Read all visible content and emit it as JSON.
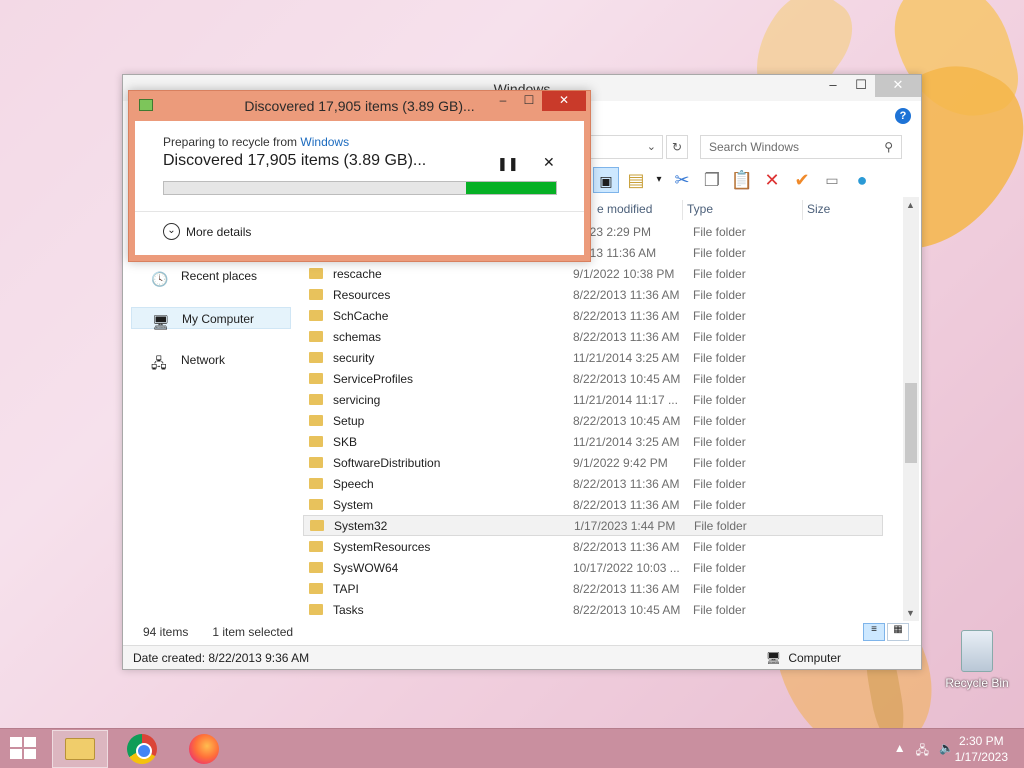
{
  "explorer": {
    "title": "Windows",
    "search_placeholder": "Search Windows",
    "columns": [
      "e modified",
      "Type",
      "Size"
    ],
    "nav_items": [
      "Recent places",
      "My Computer",
      "Network"
    ],
    "rows": [
      {
        "name": "",
        "date": "/2023 2:29 PM",
        "type": "File folder"
      },
      {
        "name": "",
        "date": "/2013 11:36 AM",
        "type": "File folder"
      },
      {
        "name": "rescache",
        "date": "9/1/2022 10:38 PM",
        "type": "File folder"
      },
      {
        "name": "Resources",
        "date": "8/22/2013 11:36 AM",
        "type": "File folder"
      },
      {
        "name": "SchCache",
        "date": "8/22/2013 11:36 AM",
        "type": "File folder"
      },
      {
        "name": "schemas",
        "date": "8/22/2013 11:36 AM",
        "type": "File folder"
      },
      {
        "name": "security",
        "date": "11/21/2014 3:25 AM",
        "type": "File folder"
      },
      {
        "name": "ServiceProfiles",
        "date": "8/22/2013 10:45 AM",
        "type": "File folder"
      },
      {
        "name": "servicing",
        "date": "11/21/2014 11:17 ...",
        "type": "File folder"
      },
      {
        "name": "Setup",
        "date": "8/22/2013 10:45 AM",
        "type": "File folder"
      },
      {
        "name": "SKB",
        "date": "11/21/2014 3:25 AM",
        "type": "File folder"
      },
      {
        "name": "SoftwareDistribution",
        "date": "9/1/2022 9:42 PM",
        "type": "File folder"
      },
      {
        "name": "Speech",
        "date": "8/22/2013 11:36 AM",
        "type": "File folder"
      },
      {
        "name": "System",
        "date": "8/22/2013 11:36 AM",
        "type": "File folder"
      },
      {
        "name": "System32",
        "date": "1/17/2023 1:44 PM",
        "type": "File folder",
        "selected": true
      },
      {
        "name": "SystemResources",
        "date": "8/22/2013 11:36 AM",
        "type": "File folder"
      },
      {
        "name": "SysWOW64",
        "date": "10/17/2022 10:03 ...",
        "type": "File folder"
      },
      {
        "name": "TAPI",
        "date": "8/22/2013 11:36 AM",
        "type": "File folder"
      },
      {
        "name": "Tasks",
        "date": "8/22/2013 10:45 AM",
        "type": "File folder"
      }
    ],
    "item_count": "94 items",
    "selected_count": "1 item selected",
    "date_created": "Date created: 8/22/2013 9:36 AM",
    "location": "Computer"
  },
  "dialog": {
    "title": "Discovered 17,905 items (3.89 GB)...",
    "prep_text": "Preparing to recycle from",
    "prep_link": "Windows",
    "status": "Discovered 17,905 items (3.89 GB)...",
    "progress_fraction": 0.23,
    "more_details": "More details",
    "accent_color": "#06b025"
  },
  "desktop": {
    "recycle_bin_label": "Recycle Bin"
  },
  "taskbar": {
    "time": "2:30 PM",
    "date": "1/17/2023"
  }
}
